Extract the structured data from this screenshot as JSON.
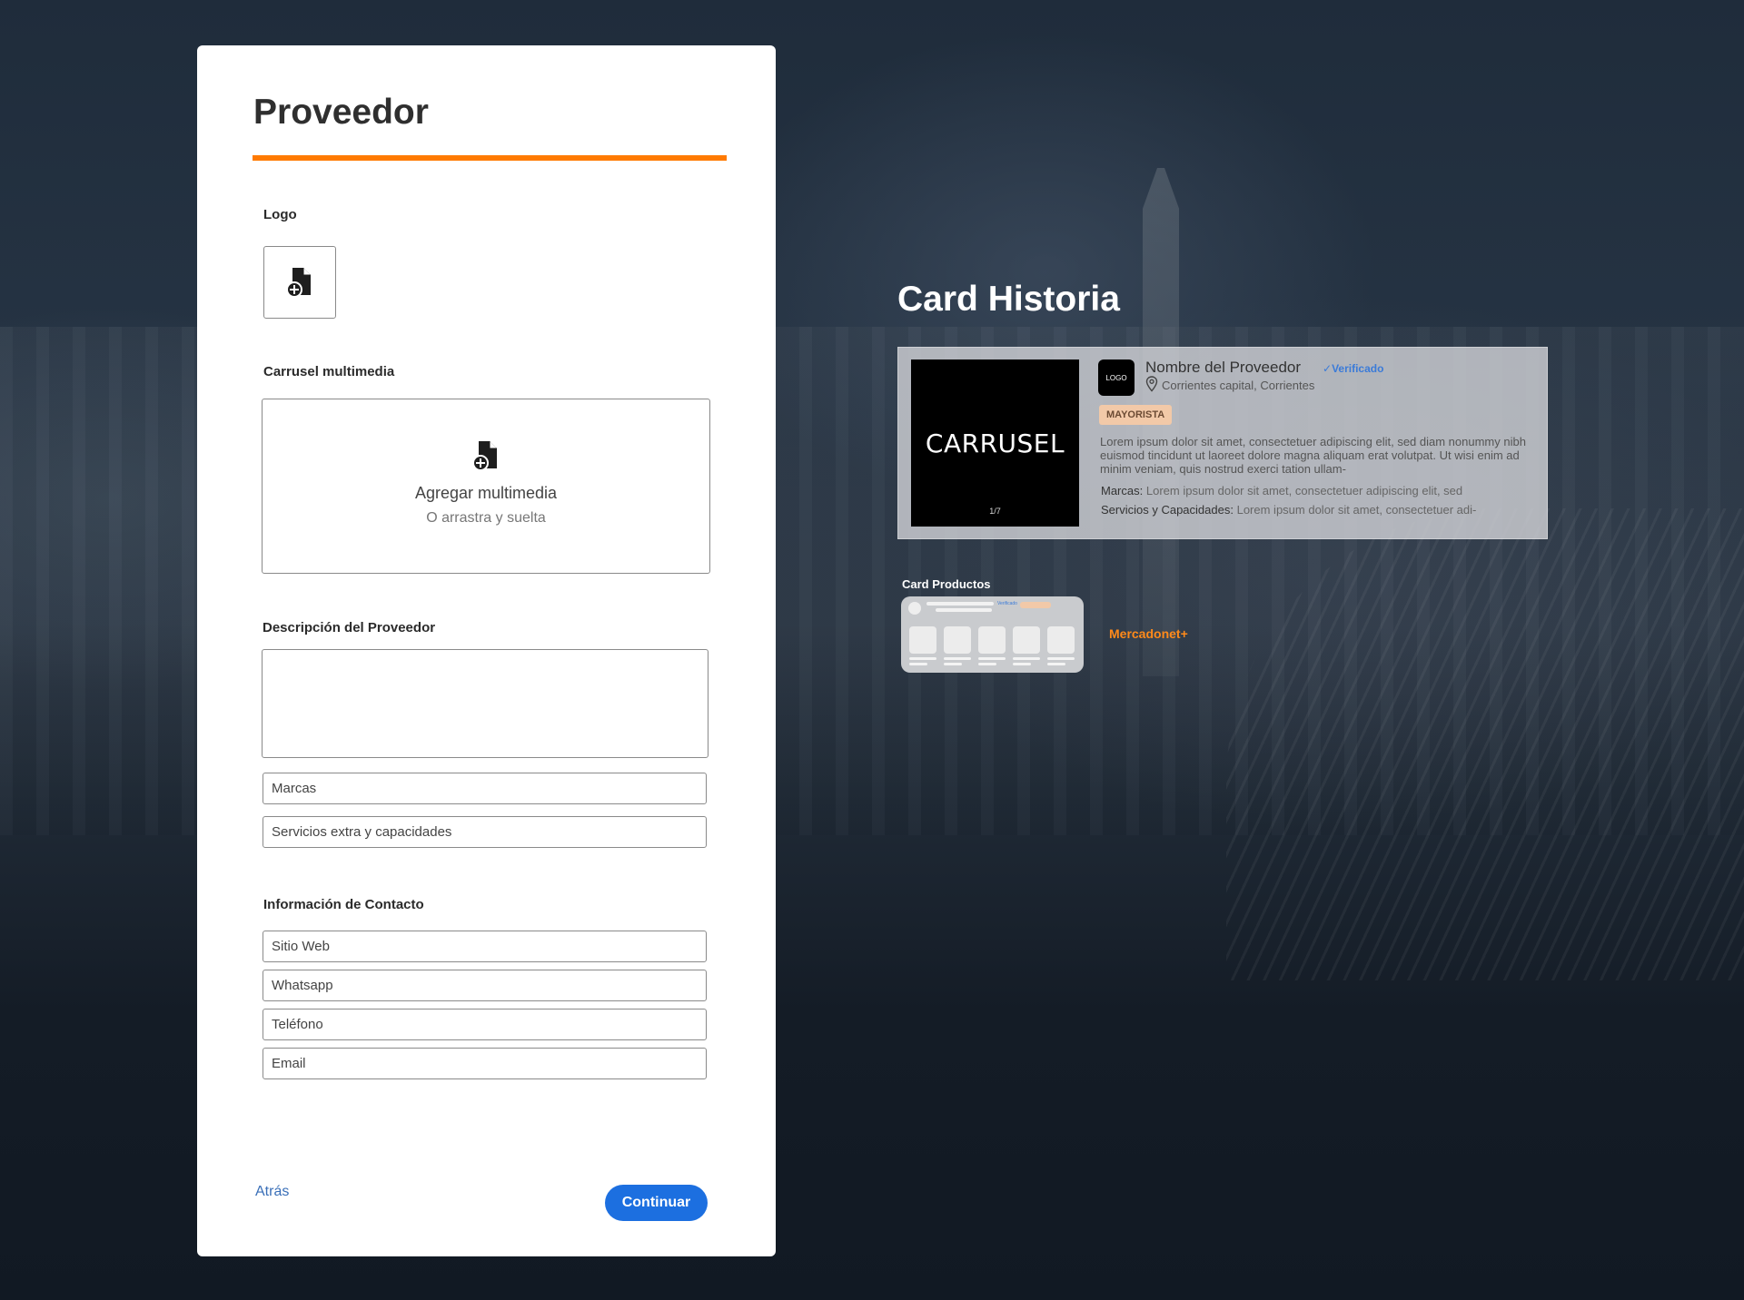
{
  "form": {
    "title": "Proveedor",
    "logo_label": "Logo",
    "carousel_label": "Carrusel multimedia",
    "carousel_primary": "Agregar multimedia",
    "carousel_secondary": "O arrastra y suelta",
    "description_label": "Descripción del Proveedor",
    "brands_placeholder": "Marcas",
    "services_placeholder": "Servicios extra y capacidades",
    "contact_label": "Información de Contacto",
    "website_placeholder": "Sitio Web",
    "whatsapp_placeholder": "Whatsapp",
    "phone_placeholder": "Teléfono",
    "email_placeholder": "Email",
    "back_label": "Atrás",
    "continue_label": "Continuar"
  },
  "preview": {
    "heading": "Card Historia",
    "carousel_text": "CARRUSEL",
    "carousel_counter": "1/7",
    "logo_text": "LOGO",
    "provider_name": "Nombre del Proveedor",
    "verified": "Verificado",
    "location": "Corrientes capital, Corrientes",
    "tag": "MAYORISTA",
    "description": "Lorem ipsum dolor sit amet, consectetuer adipiscing elit, sed diam nonummy nibh euismod tincidunt ut laoreet dolore magna aliquam erat volutpat. Ut wisi enim ad minim veniam, quis nostrud exerci tation ullam-",
    "brands_label": "Marcas:",
    "brands_text": "Lorem ipsum dolor sit amet, consectetuer adipiscing elit, sed",
    "services_label": "Servicios y Capacidades:",
    "services_text": "Lorem ipsum dolor sit amet, consectetuer adi-",
    "products_heading": "Card Productos",
    "mini_verified": "Verificado",
    "brand_link": "Mercadonet+"
  },
  "colors": {
    "accent": "#ff7a00",
    "primary_button": "#1c6fe0",
    "link": "#3a6fb8",
    "verified": "#3b7bd8",
    "tag_bg": "#f2c9a8"
  },
  "icons": {
    "upload": "file-add-icon",
    "location": "map-pin-icon"
  }
}
